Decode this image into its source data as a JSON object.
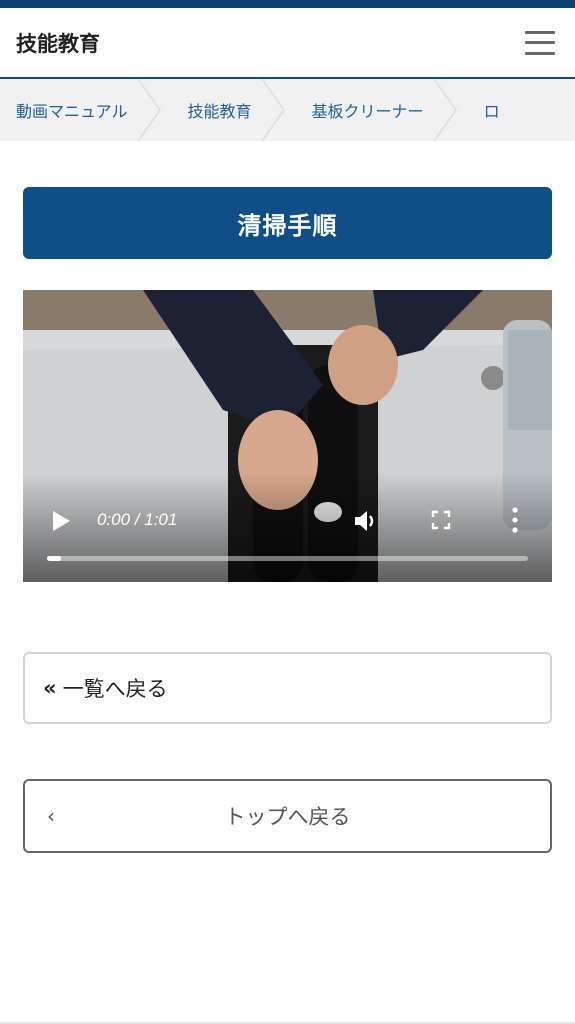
{
  "header": {
    "site_title": "技能教育",
    "menu_icon": "hamburger-menu-icon"
  },
  "breadcrumb": {
    "items": [
      {
        "label": "動画マニュアル"
      },
      {
        "label": "技能教育"
      },
      {
        "label": "基板クリーナー"
      },
      {
        "label": "ロ"
      }
    ]
  },
  "main": {
    "heading": "清掃手順",
    "video": {
      "time": "0:00 / 1:01",
      "progress": 0.0,
      "icons": [
        "play-icon",
        "volume-icon",
        "fullscreen-icon",
        "more-options-icon"
      ]
    },
    "back_list": {
      "chevron": "«",
      "label": "一覧へ戻る"
    },
    "back_top": {
      "chevron": "‹",
      "label": "トップへ戻る"
    }
  },
  "colors": {
    "brand": "#0f4e87",
    "breadcrumb_link": "#1f5f9a",
    "breadcrumb_bg": "#f1f1f1"
  }
}
